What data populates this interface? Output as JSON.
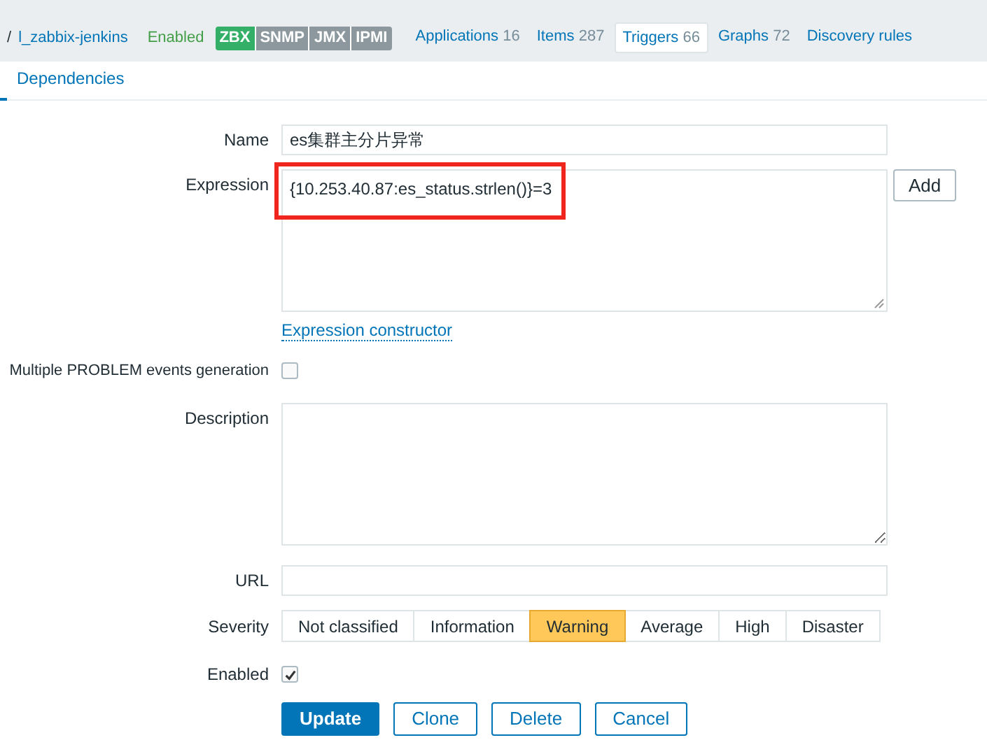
{
  "header": {
    "separator": "/",
    "host": "l_zabbix-jenkins",
    "status": "Enabled",
    "interfaces": [
      {
        "label": "ZBX",
        "active": true
      },
      {
        "label": "SNMP",
        "active": false
      },
      {
        "label": "JMX",
        "active": false
      },
      {
        "label": "IPMI",
        "active": false
      }
    ],
    "tabs": [
      {
        "label": "Applications",
        "count": "16",
        "selected": false
      },
      {
        "label": "Items",
        "count": "287",
        "selected": false
      },
      {
        "label": "Triggers",
        "count": "66",
        "selected": true
      },
      {
        "label": "Graphs",
        "count": "72",
        "selected": false
      },
      {
        "label": "Discovery rules",
        "selected": false
      }
    ]
  },
  "subtabs": [
    {
      "label": "Dependencies",
      "selected": false
    }
  ],
  "form": {
    "name": {
      "label": "Name",
      "value": "es集群主分片异常"
    },
    "expression": {
      "label": "Expression",
      "value": "{10.253.40.87:es_status.strlen()}=3",
      "highlighted": true,
      "add_button": "Add",
      "constructor_link": "Expression constructor"
    },
    "multiple_events": {
      "label": "Multiple PROBLEM events generation",
      "checked": false
    },
    "description": {
      "label": "Description"
    },
    "url": {
      "label": "URL"
    },
    "severity": {
      "label": "Severity",
      "options": [
        {
          "label": "Not classified",
          "selected": false
        },
        {
          "label": "Information",
          "selected": false
        },
        {
          "label": "Warning",
          "selected": true
        },
        {
          "label": "Average",
          "selected": false
        },
        {
          "label": "High",
          "selected": false
        },
        {
          "label": "Disaster",
          "selected": false
        }
      ]
    },
    "enabled": {
      "label": "Enabled",
      "checked": true
    }
  },
  "buttons": [
    {
      "label": "Update",
      "primary": true
    },
    {
      "label": "Clone",
      "primary": false
    },
    {
      "label": "Delete",
      "primary": false
    },
    {
      "label": "Cancel",
      "primary": false
    }
  ]
}
